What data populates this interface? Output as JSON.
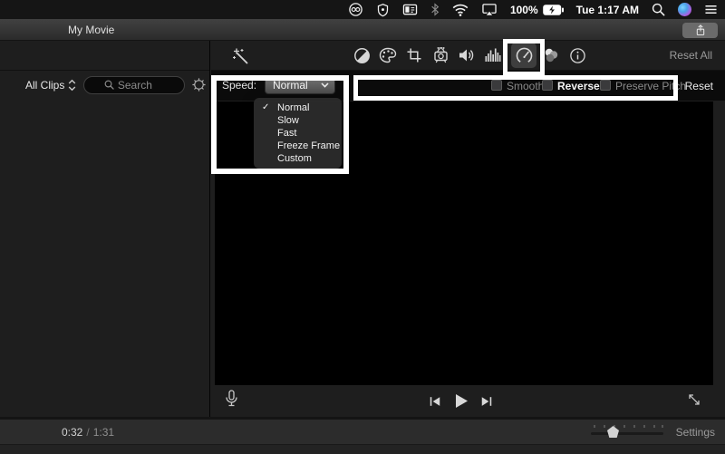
{
  "colors": {
    "highlight_box": "#ffffff",
    "video_background": "#000000",
    "selected_tool_background": "#3e3e3e"
  },
  "menubar": {
    "battery_percent": "100%",
    "clock": "Tue 1:17 AM",
    "icons": [
      "creative-cloud",
      "shield",
      "app-window",
      "bluetooth",
      "wifi",
      "airplay-display",
      "battery",
      "spotlight-search",
      "siri",
      "notification-list"
    ]
  },
  "titlebar": {
    "title": "My Movie"
  },
  "toolbar": {
    "reset_all": "Reset All",
    "icons": [
      "enhance-wand",
      "color-balance",
      "color-correction",
      "crop",
      "stabilization",
      "volume",
      "noise-eq",
      "speed",
      "clip-filter",
      "info"
    ]
  },
  "browser": {
    "filter_label": "All Clips",
    "search_placeholder": "Search"
  },
  "speed": {
    "label": "Speed:",
    "value": "Normal",
    "check_glyph": "✓",
    "options": [
      {
        "label": "Normal",
        "checked": true
      },
      {
        "label": "Slow",
        "checked": false
      },
      {
        "label": "Fast",
        "checked": false
      },
      {
        "label": "Freeze Frame",
        "checked": false
      },
      {
        "label": "Custom",
        "checked": false
      }
    ],
    "checkboxes": [
      {
        "label": "Smooth",
        "emphasized": false
      },
      {
        "label": "Reverse",
        "emphasized": true
      },
      {
        "label": "Preserve Pitch",
        "emphasized": false
      }
    ],
    "reset": "Reset"
  },
  "playback": {
    "current_time": "0:32",
    "separator": "/",
    "total_time": "1:31"
  },
  "bottombar": {
    "settings": "Settings"
  }
}
